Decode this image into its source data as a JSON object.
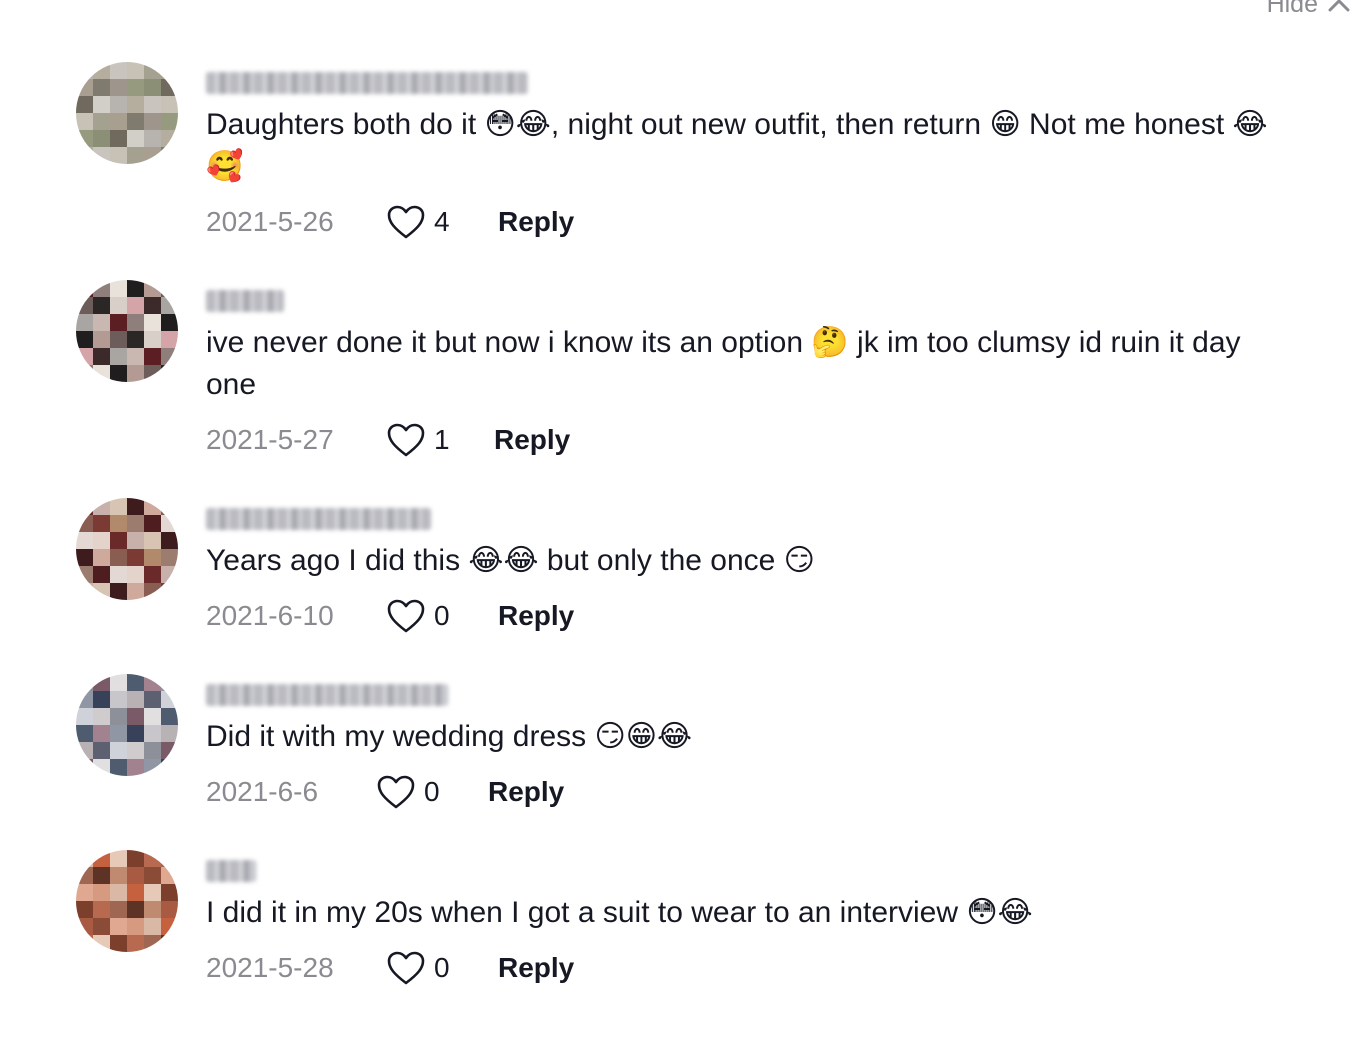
{
  "header": {
    "hide_label": "Hide"
  },
  "comments": [
    {
      "text": "Daughters both do it 😳😂, night out new outfit, then return 😁 Not me honest 😂🥰",
      "date": "2021-5-26",
      "likes": "4",
      "reply_label": "Reply"
    },
    {
      "text": "ive never done it but now i know its an option 🤔 jk im too clumsy id ruin it day one",
      "date": "2021-5-27",
      "likes": "1",
      "reply_label": "Reply"
    },
    {
      "text": "Years ago I did this 😂😂 but only the once 😏",
      "date": "2021-6-10",
      "likes": "0",
      "reply_label": "Reply"
    },
    {
      "text": "Did it with my wedding dress 😏😁😂",
      "date": "2021-6-6",
      "likes": "0",
      "reply_label": "Reply"
    },
    {
      "text": "I did it in my 20s when I got a suit to wear to an interview 😳😂",
      "date": "2021-5-28",
      "likes": "0",
      "reply_label": "Reply"
    }
  ],
  "colors": {
    "text": "#161823",
    "muted": "#8a8b91",
    "background": "#ffffff"
  },
  "icons": {
    "like": "heart-outline-icon",
    "hide": "chevron-up-icon"
  }
}
